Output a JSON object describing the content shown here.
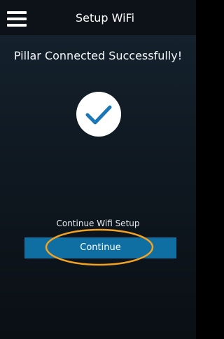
{
  "header": {
    "title": "Setup WiFi",
    "menu_icon": "hamburger-menu-icon"
  },
  "status": {
    "message": "Pillar Connected Successfully!",
    "icon": "checkmark-icon"
  },
  "continue_section": {
    "label": "Continue Wifi Setup",
    "button_label": "Continue"
  },
  "colors": {
    "button_bg": "#0f6fa3",
    "checkmark": "#1a78b8",
    "highlight_ring": "#f3a221",
    "topbar_bg": "#0c1218"
  }
}
